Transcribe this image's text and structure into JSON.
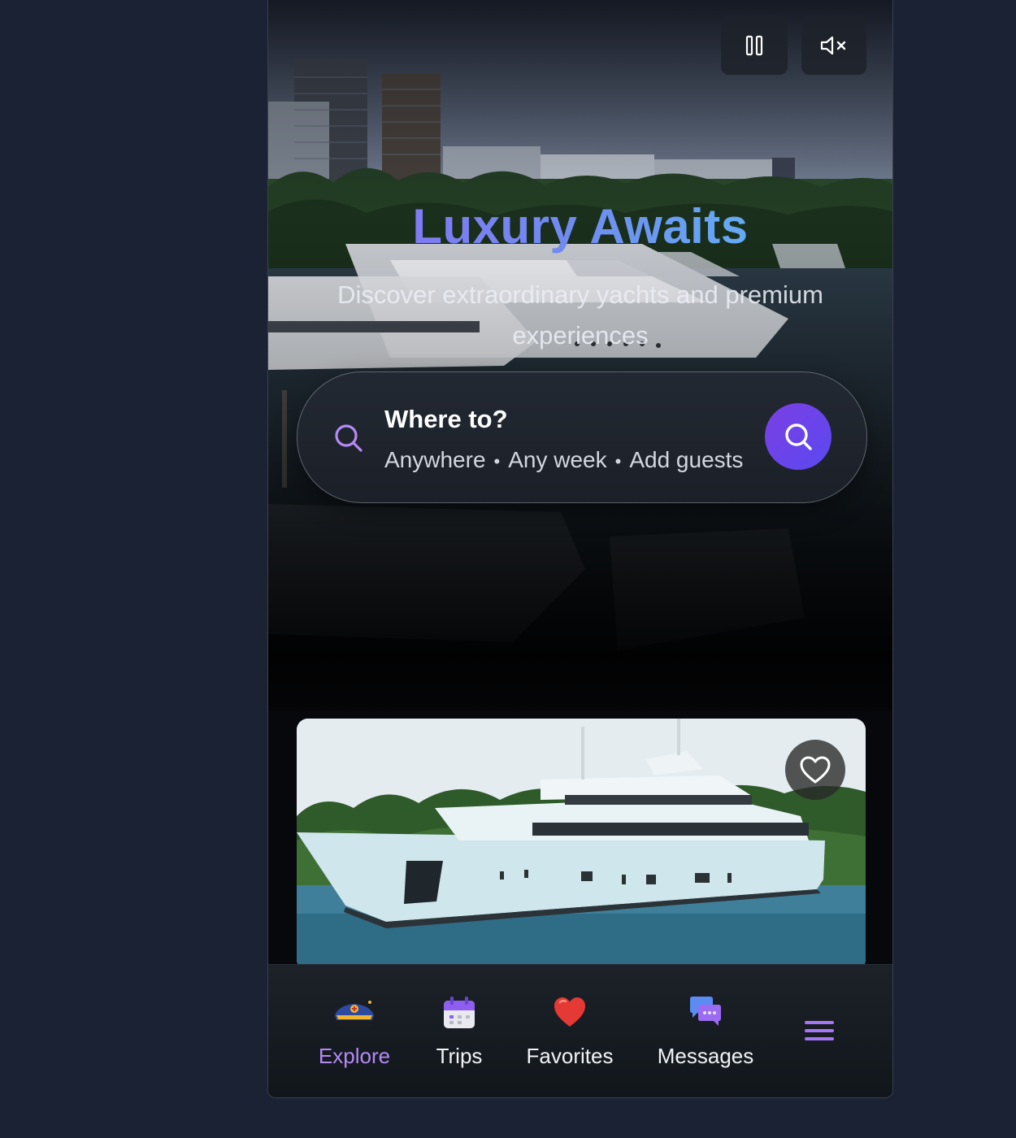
{
  "hero": {
    "title": "Luxury Awaits",
    "subtitle": "Discover extraordinary yachts and premium experiences",
    "controls": {
      "pause_icon": "pause-icon",
      "mute_icon": "volume-mute-icon"
    }
  },
  "search": {
    "title": "Where to?",
    "where": "Anywhere",
    "when": "Any week",
    "who": "Add guests",
    "icon": "search-icon"
  },
  "listing": {
    "favorite_icon": "heart-outline-icon"
  },
  "nav": {
    "items": [
      {
        "label": "Explore",
        "icon": "yacht-explore-icon",
        "active": true
      },
      {
        "label": "Trips",
        "icon": "calendar-icon",
        "active": false
      },
      {
        "label": "Favorites",
        "icon": "red-heart-icon",
        "active": false
      },
      {
        "label": "Messages",
        "icon": "chat-bubbles-icon",
        "active": false
      }
    ],
    "menu_icon": "hamburger-menu-icon"
  },
  "colors": {
    "accent": "#7b3fe4",
    "active_nav": "#b48af5",
    "title_gradient": [
      "#8b6cf5",
      "#5bc6f4"
    ]
  }
}
